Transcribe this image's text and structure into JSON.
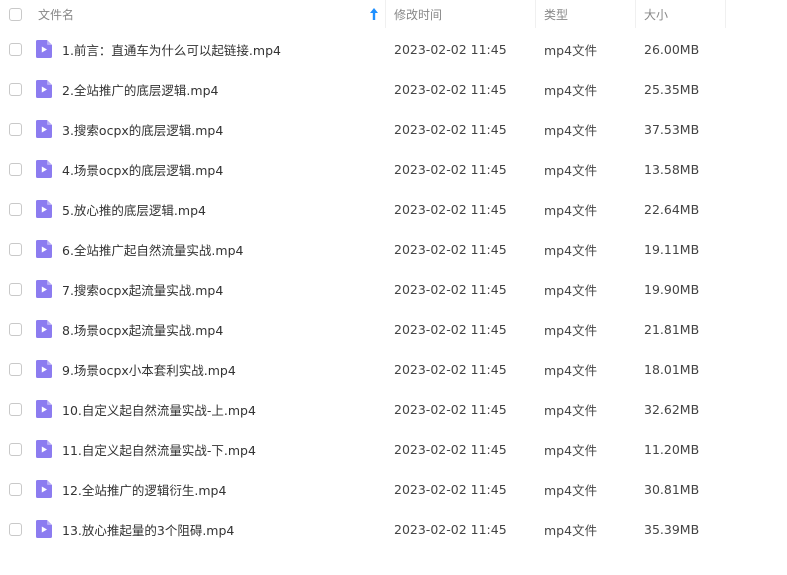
{
  "header": {
    "name_label": "文件名",
    "time_label": "修改时间",
    "type_label": "类型",
    "size_label": "大小"
  },
  "colors": {
    "accent": "#1e90ff",
    "video_icon": "#8c7cf0"
  },
  "files": [
    {
      "name": "1.前言：直通车为什么可以起链接.mp4",
      "time": "2023-02-02 11:45",
      "type": "mp4文件",
      "size": "26.00MB"
    },
    {
      "name": "2.全站推广的底层逻辑.mp4",
      "time": "2023-02-02 11:45",
      "type": "mp4文件",
      "size": "25.35MB"
    },
    {
      "name": "3.搜索ocpx的底层逻辑.mp4",
      "time": "2023-02-02 11:45",
      "type": "mp4文件",
      "size": "37.53MB"
    },
    {
      "name": "4.场景ocpx的底层逻辑.mp4",
      "time": "2023-02-02 11:45",
      "type": "mp4文件",
      "size": "13.58MB"
    },
    {
      "name": "5.放心推的底层逻辑.mp4",
      "time": "2023-02-02 11:45",
      "type": "mp4文件",
      "size": "22.64MB"
    },
    {
      "name": "6.全站推广起自然流量实战.mp4",
      "time": "2023-02-02 11:45",
      "type": "mp4文件",
      "size": "19.11MB"
    },
    {
      "name": "7.搜索ocpx起流量实战.mp4",
      "time": "2023-02-02 11:45",
      "type": "mp4文件",
      "size": "19.90MB"
    },
    {
      "name": "8.场景ocpx起流量实战.mp4",
      "time": "2023-02-02 11:45",
      "type": "mp4文件",
      "size": "21.81MB"
    },
    {
      "name": "9.场景ocpx小本套利实战.mp4",
      "time": "2023-02-02 11:45",
      "type": "mp4文件",
      "size": "18.01MB"
    },
    {
      "name": "10.自定义起自然流量实战-上.mp4",
      "time": "2023-02-02 11:45",
      "type": "mp4文件",
      "size": "32.62MB"
    },
    {
      "name": "11.自定义起自然流量实战-下.mp4",
      "time": "2023-02-02 11:45",
      "type": "mp4文件",
      "size": "11.20MB"
    },
    {
      "name": "12.全站推广的逻辑衍生.mp4",
      "time": "2023-02-02 11:45",
      "type": "mp4文件",
      "size": "30.81MB"
    },
    {
      "name": "13.放心推起量的3个阻碍.mp4",
      "time": "2023-02-02 11:45",
      "type": "mp4文件",
      "size": "35.39MB"
    }
  ]
}
